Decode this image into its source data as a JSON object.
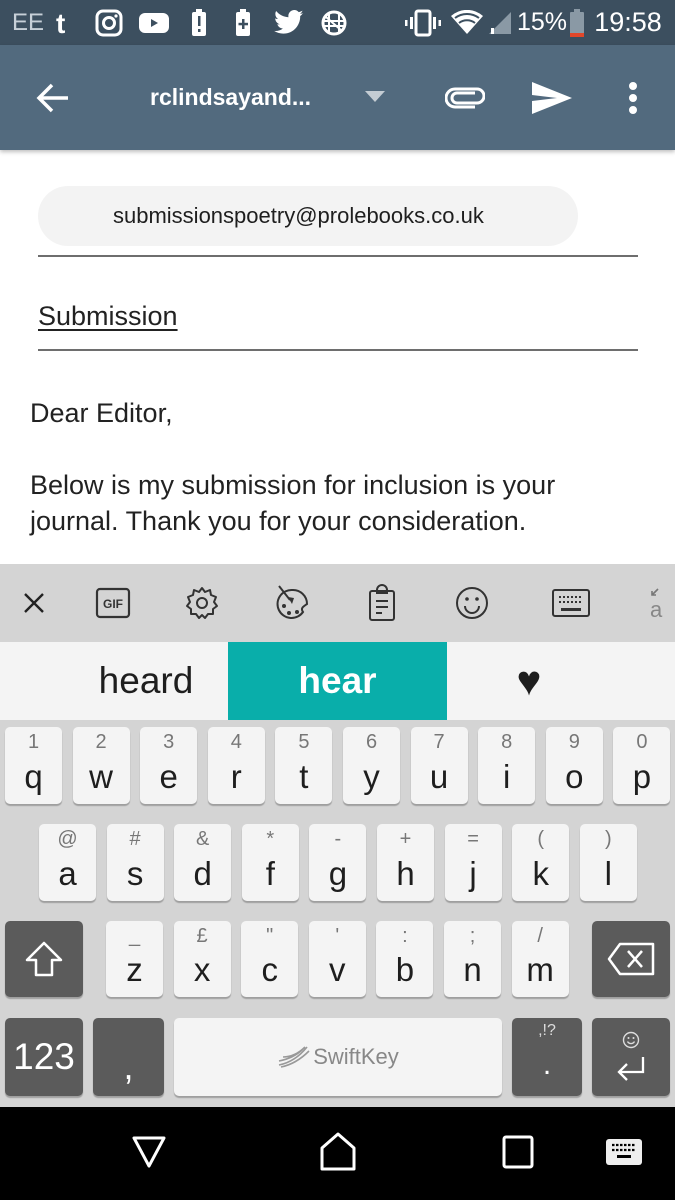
{
  "status_bar": {
    "carrier": "EE",
    "notification_icons": [
      "tumblr-icon",
      "instagram-icon",
      "youtube-icon",
      "battery-alert-icon",
      "battery-plus-icon",
      "twitter-icon",
      "data-saver-icon"
    ],
    "system_icons": [
      "vibrate-icon",
      "wifi-icon",
      "cell-signal-icon"
    ],
    "battery_percent": "15%",
    "battery_level": 0.15,
    "time": "19:58"
  },
  "app_bar": {
    "from_account": "rclindsayand...",
    "actions": [
      "back",
      "account-dropdown",
      "attach",
      "send",
      "more"
    ]
  },
  "compose": {
    "to": "submissionspoetry@prolebooks.co.uk",
    "subject": "Submission",
    "body": [
      "Dear Editor,",
      "Below is my submission for inclusion is your journal. Thank you for your consideration."
    ]
  },
  "keyboard": {
    "toolbar_icons": [
      "close",
      "gif",
      "settings",
      "themes",
      "clipboard",
      "emoji",
      "layout",
      "handwriting"
    ],
    "gif_label": "GIF",
    "handwriting_label": "a",
    "suggestions": {
      "left": "heard",
      "middle": "hear",
      "right": "♥"
    },
    "accent_color": "#09aeaa",
    "row1": [
      {
        "main": "q",
        "alt": "1"
      },
      {
        "main": "w",
        "alt": "2"
      },
      {
        "main": "e",
        "alt": "3"
      },
      {
        "main": "r",
        "alt": "4"
      },
      {
        "main": "t",
        "alt": "5"
      },
      {
        "main": "y",
        "alt": "6"
      },
      {
        "main": "u",
        "alt": "7"
      },
      {
        "main": "i",
        "alt": "8"
      },
      {
        "main": "o",
        "alt": "9"
      },
      {
        "main": "p",
        "alt": "0"
      }
    ],
    "row2": [
      {
        "main": "a",
        "alt": "@"
      },
      {
        "main": "s",
        "alt": "#"
      },
      {
        "main": "d",
        "alt": "&"
      },
      {
        "main": "f",
        "alt": "*"
      },
      {
        "main": "g",
        "alt": "-"
      },
      {
        "main": "h",
        "alt": "+"
      },
      {
        "main": "j",
        "alt": "="
      },
      {
        "main": "k",
        "alt": "("
      },
      {
        "main": "l",
        "alt": ")"
      }
    ],
    "row3": [
      {
        "main": "z",
        "alt": "_"
      },
      {
        "main": "x",
        "alt": "£"
      },
      {
        "main": "c",
        "alt": "\""
      },
      {
        "main": "v",
        "alt": "'"
      },
      {
        "main": "b",
        "alt": ":"
      },
      {
        "main": "n",
        "alt": ";"
      },
      {
        "main": "m",
        "alt": "/"
      }
    ],
    "numbers_label": "123",
    "comma_label": ",",
    "space_label": "SwiftKey",
    "punct_alt": ",!?",
    "punct_main": "."
  },
  "nav_bar": {
    "buttons": [
      "back",
      "home",
      "recents",
      "keyboard-switch"
    ]
  }
}
